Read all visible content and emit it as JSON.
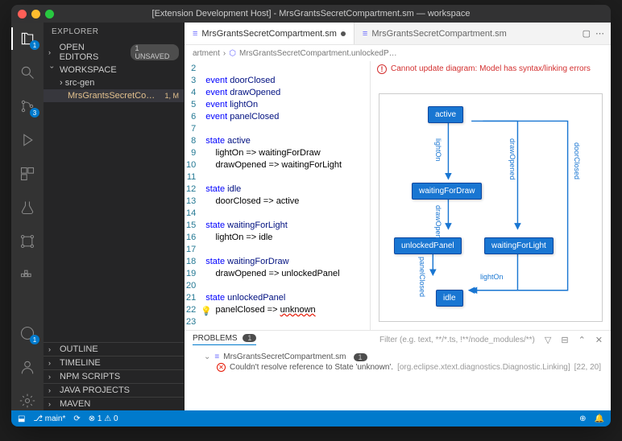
{
  "title": "[Extension Development Host] - MrsGrantsSecretCompartment.sm — workspace",
  "activity": {
    "badges": {
      "explorer": "1",
      "scm": "3",
      "ext": "1"
    }
  },
  "sidebar": {
    "title": "EXPLORER",
    "openEditors": {
      "label": "OPEN EDITORS",
      "unsaved": "1 UNSAVED"
    },
    "workspace": {
      "label": "WORKSPACE",
      "folder": "src-gen",
      "file": "MrsGrantsSecretCompartm…",
      "fileCount": "1",
      "fileGit": "M"
    },
    "outline": "OUTLINE",
    "timeline": "TIMELINE",
    "npm": "NPM SCRIPTS",
    "java": "JAVA PROJECTS",
    "maven": "MAVEN"
  },
  "tabs": {
    "tab1": "MrsGrantsSecretCompartment.sm",
    "tab2": "MrsGrantsSecretCompartment.sm"
  },
  "breadcrumb": {
    "p1": "artment",
    "p2": "MrsGrantsSecretCompartment.unlockedP…"
  },
  "code": {
    "lines": [
      "2",
      "3",
      "4",
      "5",
      "6",
      "7",
      "8",
      "9",
      "10",
      "11",
      "12",
      "13",
      "14",
      "15",
      "16",
      "17",
      "18",
      "19",
      "20",
      "21",
      "22",
      "23"
    ],
    "l3": "event doorClosed",
    "l4": "event drawOpened",
    "l5": "event lightOn",
    "l6": "event panelClosed",
    "l8": "state active",
    "l9": "    lightOn => waitingForDraw",
    "l10": "    drawOpened => waitingForLight",
    "l12": "state idle",
    "l13": "    doorClosed => active",
    "l15": "state waitingForLight",
    "l16": "    lightOn => idle",
    "l18": "state waitingForDraw",
    "l19": "    drawOpened => unlockedPanel",
    "l21": "state unlockedPanel",
    "l22a": "    panelClosed => ",
    "l22b": "unknown"
  },
  "diagram": {
    "error": "Cannot update diagram: Model has syntax/linking errors",
    "states": {
      "active": "active",
      "waitingForDraw": "waitingForDraw",
      "unlockedPanel": "unlockedPanel",
      "waitingForLight": "waitingForLight",
      "idle": "idle"
    },
    "edges": {
      "lightOn1": "lightOn",
      "drawOpened1": "drawOpened",
      "doorClosed": "doorClosed",
      "drawOpened2": "drawOpened",
      "panelClosed": "panelClosed",
      "lightOn2": "lightOn"
    }
  },
  "panel": {
    "tab": "PROBLEMS",
    "count": "1",
    "filter": "Filter (e.g. text, **/*.ts, !**/node_modules/**)",
    "file": "MrsGrantsSecretCompartment.sm",
    "fileCount": "1",
    "msg": "Couldn't resolve reference to State 'unknown'.",
    "src": "[org.eclipse.xtext.diagnostics.Diagnostic.Linking]",
    "loc": "[22, 20]"
  },
  "status": {
    "branch": "main*",
    "sync": "⟳",
    "errwarn": "⊗ 1 ⚠ 0"
  }
}
